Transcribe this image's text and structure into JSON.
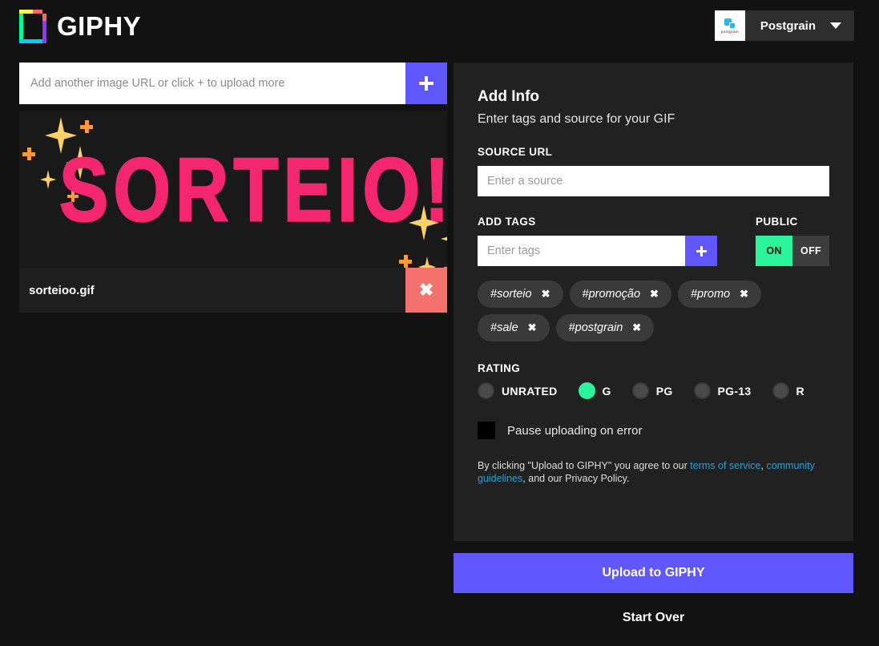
{
  "header": {
    "brand_name": "GIPHY",
    "logo_icon": "giphy-page-logo-icon",
    "account": {
      "name": "Postgrain",
      "avatar_word": "postgrain",
      "avatar_icon": "postgrain-squares-icon",
      "caret_icon": "chevron-down-icon"
    }
  },
  "left": {
    "url_input": {
      "value": "",
      "placeholder": "Add another image URL or click + to upload more"
    },
    "add_button_icon": "plus-icon",
    "gif": {
      "filename": "sorteioo.gif",
      "art_text": "SORTEIO!",
      "art_text_color": "#f4276e",
      "sparkle_color": "#ffd166",
      "plus_sparkle_color": "#ff9a3c",
      "delete_icon": "close-x-icon"
    }
  },
  "panel": {
    "title": "Add Info",
    "subtitle": "Enter tags and source for your GIF",
    "source_label": "SOURCE URL",
    "source_input": {
      "value": "",
      "placeholder": "Enter a source"
    },
    "tags_label": "ADD TAGS",
    "tags_input": {
      "value": "",
      "placeholder": "Enter tags"
    },
    "tags_add_icon": "plus-icon",
    "public_label": "PUBLIC",
    "public_on": "ON",
    "public_off": "OFF",
    "public_selected": "ON",
    "tags": [
      {
        "label": "#sorteio",
        "remove_icon": "close-x-icon"
      },
      {
        "label": "#promoção",
        "remove_icon": "close-x-icon"
      },
      {
        "label": "#promo",
        "remove_icon": "close-x-icon"
      },
      {
        "label": "#sale",
        "remove_icon": "close-x-icon"
      },
      {
        "label": "#postgrain",
        "remove_icon": "close-x-icon"
      }
    ],
    "rating_label": "RATING",
    "ratings": [
      {
        "label": "UNRATED",
        "selected": false
      },
      {
        "label": "G",
        "selected": true
      },
      {
        "label": "PG",
        "selected": false
      },
      {
        "label": "PG-13",
        "selected": false
      },
      {
        "label": "R",
        "selected": false
      }
    ],
    "pause_label": "Pause uploading on error",
    "pause_checked": false,
    "terms": {
      "part1": "By clicking \"Upload to GIPHY\" you agree to our ",
      "link1": "terms of service",
      "comma": ", ",
      "link2": "community guidelines",
      "part2": ", and our Privacy Policy."
    }
  },
  "footer": {
    "upload_label": "Upload to GIPHY",
    "start_over_label": "Start Over"
  },
  "colors": {
    "page_bg": "#121212",
    "panel_bg": "#212121",
    "accent_purple": "#6157ff",
    "accent_green": "#2bf59a",
    "delete_red": "#f4716e",
    "link_blue": "#2b9fd9"
  }
}
